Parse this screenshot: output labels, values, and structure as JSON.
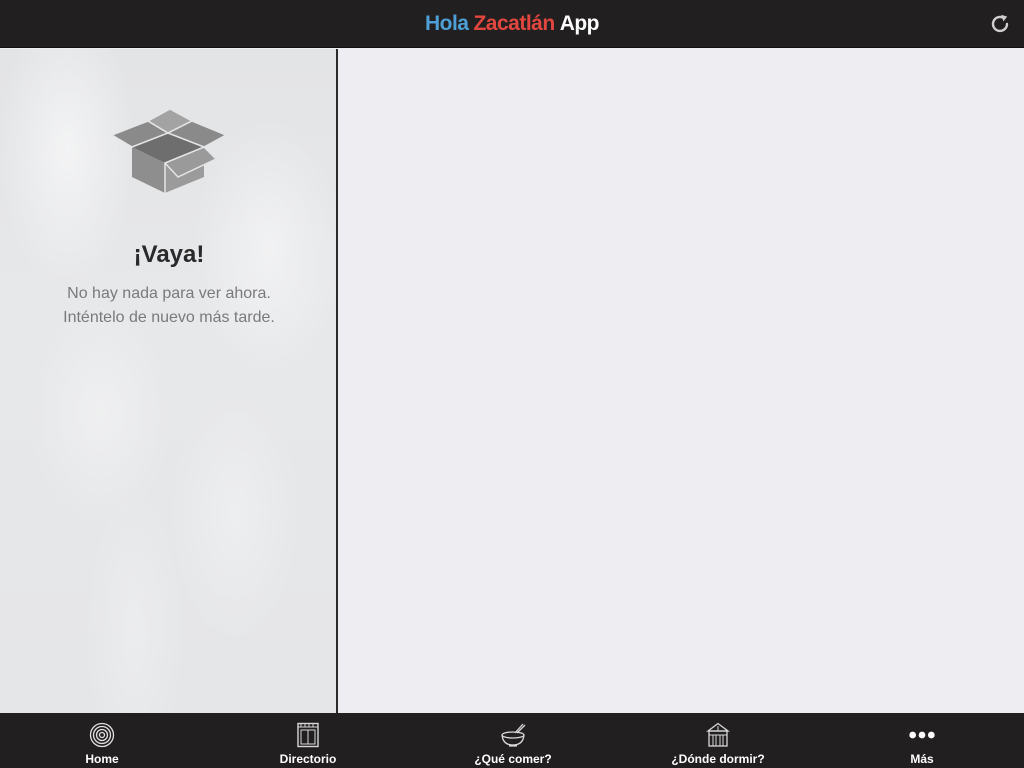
{
  "header": {
    "title_part1": "Hola",
    "title_part2": "Zacatlán",
    "title_part3": "App",
    "refresh_icon": "refresh-icon",
    "colors": {
      "background": "#221f20",
      "title_blue": "#4d9fd6",
      "title_red": "#e2473f",
      "title_white": "#ffffff"
    }
  },
  "empty_state": {
    "icon": "empty-box-icon",
    "title": "¡Vaya!",
    "line1": "No hay nada para ver ahora.",
    "line2": "Inténtelo de nuevo más tarde."
  },
  "tabbar": {
    "tabs": [
      {
        "label": "Home",
        "icon": "target-icon"
      },
      {
        "label": "Directorio",
        "icon": "building-icon"
      },
      {
        "label": "¿Qué comer?",
        "icon": "bowl-icon"
      },
      {
        "label": "¿Dónde dormir?",
        "icon": "house-icon"
      },
      {
        "label": "Más",
        "icon": "more-dots-icon"
      }
    ]
  }
}
